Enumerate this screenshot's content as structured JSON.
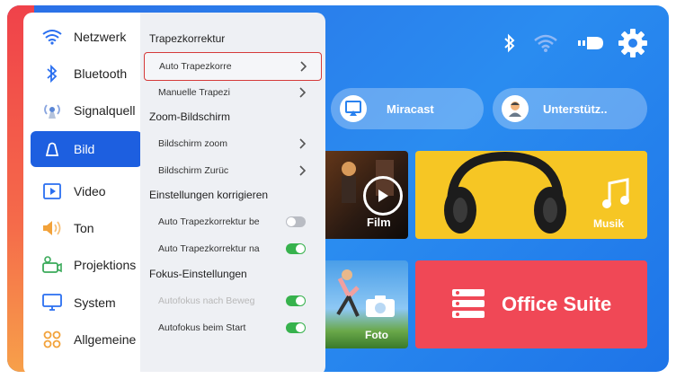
{
  "menu": {
    "items": [
      {
        "label": "Netzwerk",
        "icon": "wifi-icon"
      },
      {
        "label": "Bluetooth",
        "icon": "bluetooth-icon"
      },
      {
        "label": "Signalquell",
        "icon": "signal-source-icon"
      },
      {
        "label": "Bild",
        "icon": "picture-icon",
        "active": true
      },
      {
        "label": "Video",
        "icon": "video-icon"
      },
      {
        "label": "Ton",
        "icon": "speaker-icon"
      },
      {
        "label": "Projektions",
        "icon": "projection-icon"
      },
      {
        "label": "System",
        "icon": "monitor-icon"
      },
      {
        "label": "Allgemeine",
        "icon": "general-grid-icon"
      }
    ]
  },
  "submenu": {
    "sections": [
      {
        "title": "Trapezkorrektur"
      },
      {
        "title": "Zoom-Bildschirm"
      },
      {
        "title": "Einstellungen korrigieren"
      },
      {
        "title": "Fokus-Einstellungen"
      }
    ],
    "rows": [
      {
        "label": "Auto Trapezkorre",
        "control": "chevron",
        "selected": true
      },
      {
        "label": "Manuelle Trapezi",
        "control": "chevron"
      },
      {
        "label": "Bildschirm zoom",
        "control": "chevron"
      },
      {
        "label": "Bildschirm Zurüc",
        "control": "chevron"
      },
      {
        "label": "Auto Trapezkorrektur be",
        "control": "toggle",
        "state": "off"
      },
      {
        "label": "Auto Trapezkorrektur na",
        "control": "toggle",
        "state": "on"
      },
      {
        "label": "Autofokus nach Beweg",
        "control": "toggle",
        "state": "on",
        "disabled": true
      },
      {
        "label": "Autofokus beim Start",
        "control": "toggle",
        "state": "on"
      }
    ]
  },
  "status_icons": [
    "bluetooth-icon",
    "wifi-icon",
    "projector-light-icon",
    "settings-gear-icon"
  ],
  "pills": [
    {
      "label": "Miracast",
      "icon": "miracast-icon"
    },
    {
      "label": "Unterstütz..",
      "icon": "support-avatar-icon"
    }
  ],
  "tiles": [
    {
      "label": "Film",
      "icon": "play-icon"
    },
    {
      "label": "Musik",
      "icon": "music-notes-icon"
    },
    {
      "label": "Foto",
      "icon": "camera-icon"
    },
    {
      "label": "Office Suite",
      "icon": "office-suite-icon"
    }
  ],
  "colors": {
    "background": "#2a82ef",
    "menu_active": "#1d5fe0",
    "selection_border": "#d53a3a",
    "toggle_on": "#37b24d",
    "toggle_off": "#b9bcc3",
    "musik_tile": "#f6c624",
    "office_tile": "#f04856"
  }
}
